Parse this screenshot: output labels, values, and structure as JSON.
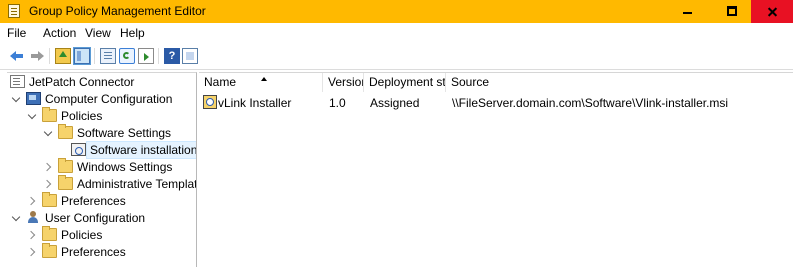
{
  "window": {
    "title": "Group Policy Management Editor",
    "app_icon": "gpo-editor-icon",
    "controls": [
      "minimize-icon",
      "maximize-icon",
      "close-icon"
    ]
  },
  "menu": [
    "File",
    "Action",
    "View",
    "Help"
  ],
  "toolbar": {
    "icons": [
      "back-arrow-icon",
      "forward-arrow-icon",
      "up-folder-icon",
      "show-hide-tree-icon",
      "list-view-icon",
      "refresh-icon",
      "export-list-icon",
      "help-icon",
      "properties-icon"
    ]
  },
  "tree": {
    "root": "JetPatch Connector",
    "computer_configuration": "Computer Configuration",
    "cc_policies": "Policies",
    "software_settings": "Software Settings",
    "software_installation": "Software installation",
    "windows_settings": "Windows Settings",
    "administrative_templates": "Administrative Templates: I",
    "cc_preferences": "Preferences",
    "user_configuration": "User Configuration",
    "uc_policies": "Policies",
    "uc_preferences": "Preferences"
  },
  "list": {
    "columns": [
      "Name",
      "Version",
      "Deployment st...",
      "Source"
    ],
    "rows": [
      {
        "name": "vLink Installer",
        "version": "1.0",
        "deployment": "Assigned",
        "source": "\\\\FileServer.domain.com\\Software\\Vlink-installer.msi"
      }
    ]
  },
  "colors": {
    "titlebar": "#ffb900",
    "close_button": "#e81123",
    "selection": "#e5f3ff"
  }
}
